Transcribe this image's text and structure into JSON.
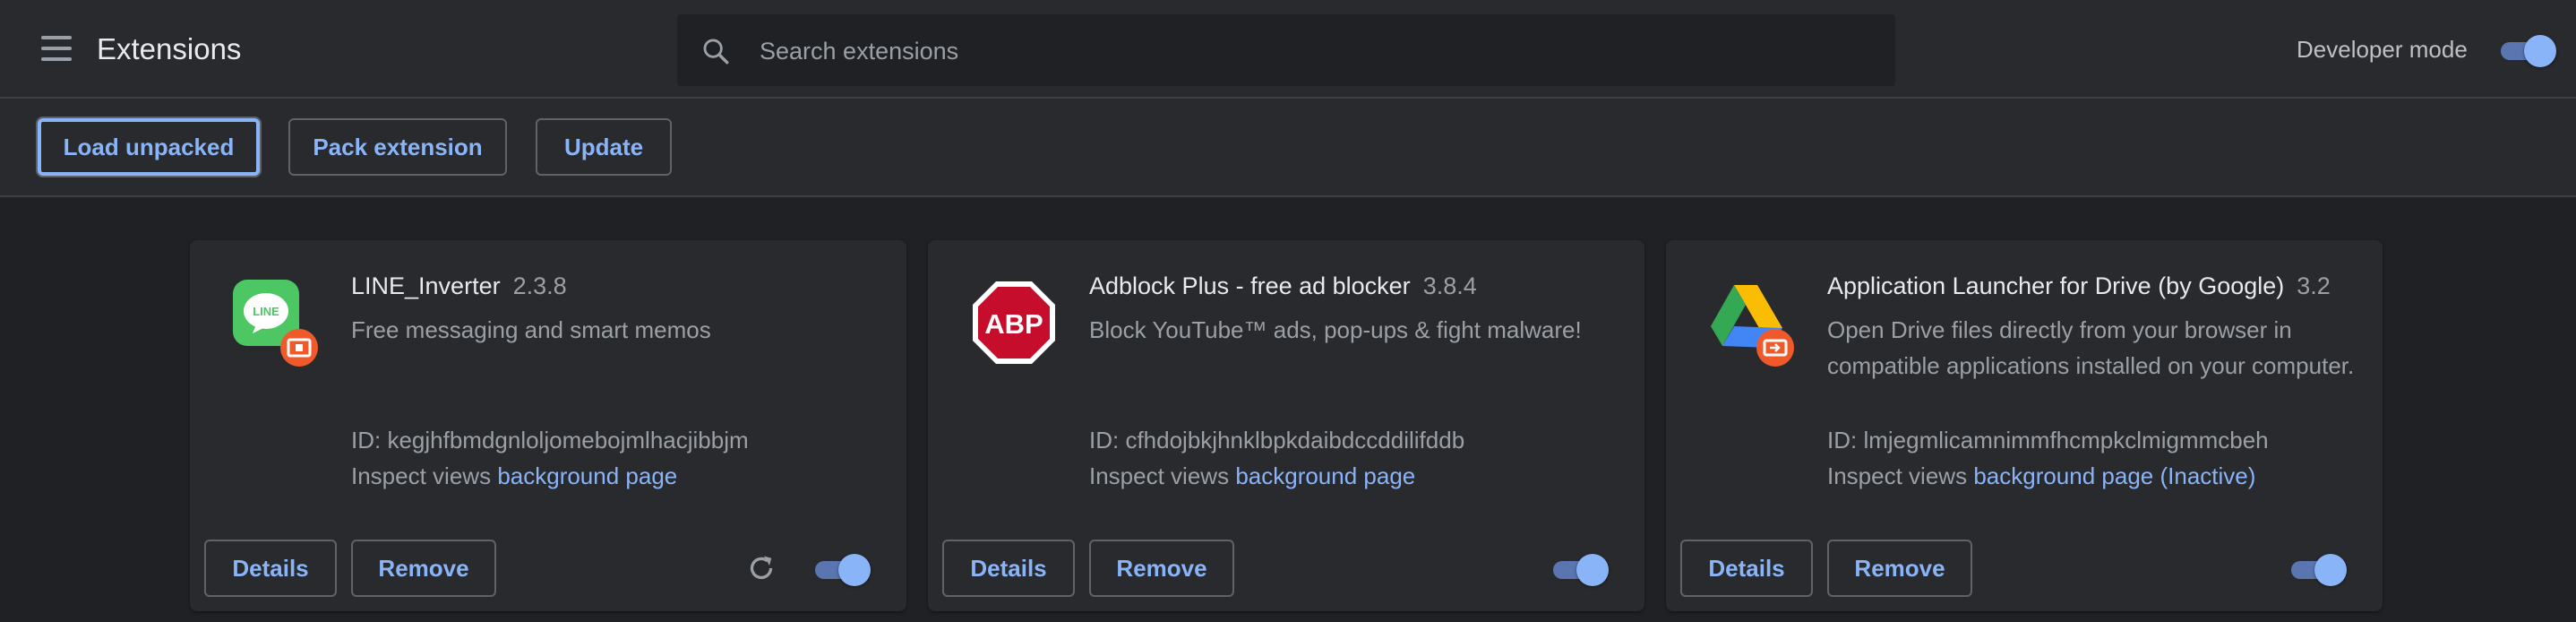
{
  "header": {
    "title": "Extensions",
    "search_placeholder": "Search extensions",
    "developer_mode_label": "Developer mode",
    "developer_mode_on": true
  },
  "toolbar": {
    "load_unpacked": "Load unpacked",
    "pack_extension": "Pack extension",
    "update": "Update"
  },
  "extensions": [
    {
      "name": "LINE_Inverter",
      "version": "2.3.8",
      "description": "Free messaging and smart memos",
      "id_text": "ID: kegjhfbmdgnloljomebojmlhacjibbjm",
      "inspect_prefix": "Inspect views",
      "inspect_link": "background page",
      "details": "Details",
      "remove": "Remove",
      "enabled": true,
      "icon": "line-app-icon",
      "has_reload": true
    },
    {
      "name": "Adblock Plus - free ad blocker",
      "version": "3.8.4",
      "description": "Block YouTube™ ads, pop-ups & fight malware!",
      "id_text": "ID: cfhdojbkjhnklbpkdaibdccddilifddb",
      "inspect_prefix": "Inspect views",
      "inspect_link": "background page",
      "details": "Details",
      "remove": "Remove",
      "enabled": true,
      "icon": "abp-icon",
      "has_reload": false
    },
    {
      "name": "Application Launcher for Drive (by Google)",
      "version": "3.2",
      "description": "Open Drive files directly from your browser in compatible applications installed on your computer.",
      "id_text": "ID: lmjegmlicamnimmfhcmpkclmigmmcbeh",
      "inspect_prefix": "Inspect views",
      "inspect_link": "background page (Inactive)",
      "details": "Details",
      "remove": "Remove",
      "enabled": true,
      "icon": "google-drive-icon",
      "has_reload": false
    }
  ],
  "icon_labels": {
    "line": "LINE",
    "abp": "ABP"
  },
  "colors": {
    "accent": "#8ab4f8",
    "background": "#202124",
    "surface": "#292a2d"
  }
}
